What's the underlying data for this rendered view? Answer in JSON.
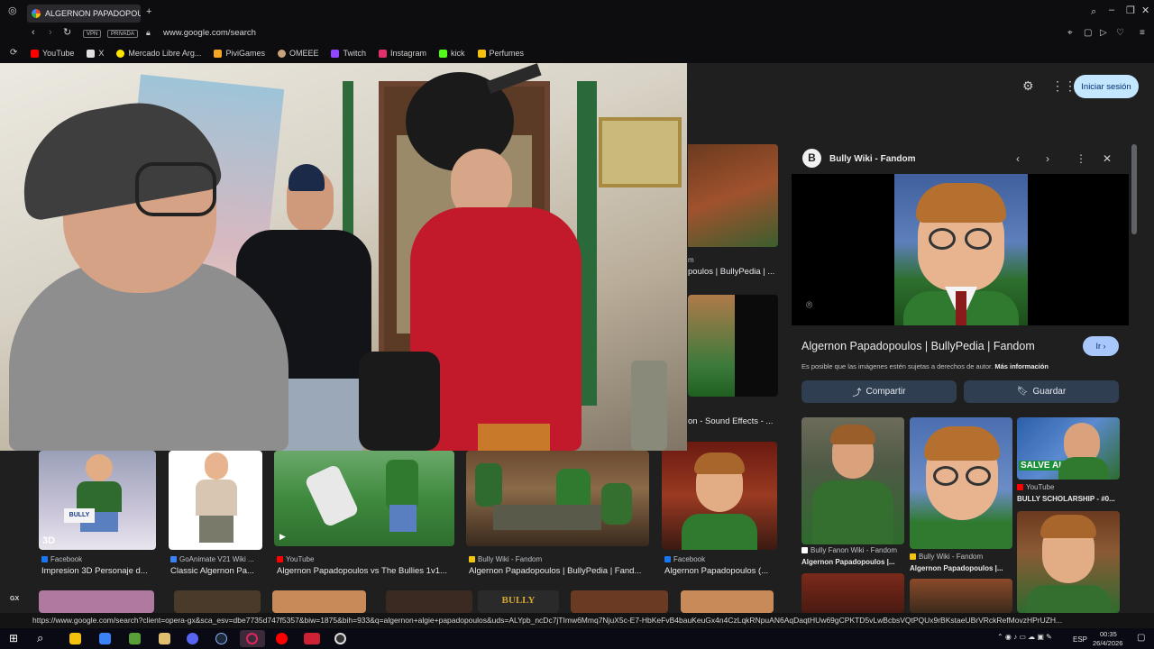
{
  "tab": {
    "title": "ALGERNON PAPADOPOULOS",
    "new_tab": "+"
  },
  "toolbar": {
    "vpn": "VPN",
    "private": "PRIVADA",
    "url": "www.google.com/search"
  },
  "bookmarks": [
    {
      "label": "YouTube",
      "color": "#ff0000"
    },
    {
      "label": "X",
      "color": "#e0e0e0"
    },
    {
      "label": "Mercado Libre Arg...",
      "color": "#ffe600"
    },
    {
      "label": "PiviGames",
      "color": "#f5a623"
    },
    {
      "label": "OMEEE",
      "color": "#c8a27a"
    },
    {
      "label": "Twitch",
      "color": "#9146ff"
    },
    {
      "label": "Instagram",
      "color": "#e1306c"
    },
    {
      "label": "kick",
      "color": "#53fc18"
    },
    {
      "label": "Perfumes",
      "color": "#f4c20d"
    }
  ],
  "google": {
    "signin": "Iniciar sesión"
  },
  "left_captions": [
    {
      "label": "poulos | BullyPedia | ..."
    },
    {
      "label": "m"
    },
    {
      "label": "on - Sound Effects - ..."
    }
  ],
  "panel": {
    "logo": "B",
    "source": "Bully Wiki - Fandom",
    "title": "Algernon Papadopoulos | BullyPedia | Fandom",
    "go": "Ir",
    "notice": "Es posible que las imágenes estén sujetas a derechos de autor.",
    "notice_link": "Más información",
    "share": "Compartir",
    "save": "Guardar",
    "related": [
      {
        "source": "Bully Fanon Wiki - Fandom",
        "title": "Algernon Papadopoulos |...",
        "icon_color": "#ffffff"
      },
      {
        "source": "Bully Wiki - Fandom",
        "title": "Algernon Papadopoulos |...",
        "icon_color": "#f1c40f"
      },
      {
        "source": "YouTube",
        "title": "BULLY SCHOLARSHIP - #0...",
        "icon_color": "#ff0000",
        "badge": "SALVE ALGE"
      }
    ]
  },
  "results": [
    {
      "source": "Facebook",
      "title": "Impresion 3D Personaje d...",
      "icon_color": "#1877f2",
      "overlay": "BULLY"
    },
    {
      "source": "GoAnimate V21 Wiki ...",
      "title": "Classic Algernon Pa...",
      "icon_color": "#3b82f6"
    },
    {
      "source": "YouTube",
      "title": "Algernon Papadopoulos vs The Bullies 1v1...",
      "icon_color": "#ff0000"
    },
    {
      "source": "Bully Wiki - Fandom",
      "title": "Algernon Papadopoulos | BullyPedia | Fand...",
      "icon_color": "#f1c40f"
    },
    {
      "source": "Facebook",
      "title": "Algernon Papadopoulos (...",
      "icon_color": "#1877f2"
    }
  ],
  "bottom_row_text": "BULLY",
  "sidebar_gx": "GX",
  "status_url": "https://www.google.com/search?client=opera-gx&sca_esv=dbe7735d747f5357&biw=1875&bih=933&q=algernon+algie+papadopoulos&uds=ALYpb_ncDc7jTImw6Mmq7NjuX5c-E7-HbKeFvB4bauKeuGx4n4CzLqkRNpuAN6AqDaqtHUw69gCPKTD5vLwBcbsVQtPQUx9rBKstaeUBrVRckRefMovzHPrUZH...",
  "taskbar": {
    "lang": "ESP",
    "time": "00:35",
    "date": "26/4/2026",
    "apps": [
      {
        "name": "search",
        "color": "#ffffff"
      },
      {
        "name": "file",
        "color": "#f4c20d"
      },
      {
        "name": "vscode",
        "color": "#3b82f6"
      },
      {
        "name": "minecraft",
        "color": "#5a9e3a"
      },
      {
        "name": "discord",
        "color": "#5865f2"
      },
      {
        "name": "steam",
        "color": "#8ab4f8"
      },
      {
        "name": "opera",
        "color": "#e0245e"
      },
      {
        "name": "youtube",
        "color": "#ff0000"
      },
      {
        "name": "twitter",
        "color": "#ff4444"
      },
      {
        "name": "obs",
        "color": "#dddddd"
      }
    ]
  }
}
